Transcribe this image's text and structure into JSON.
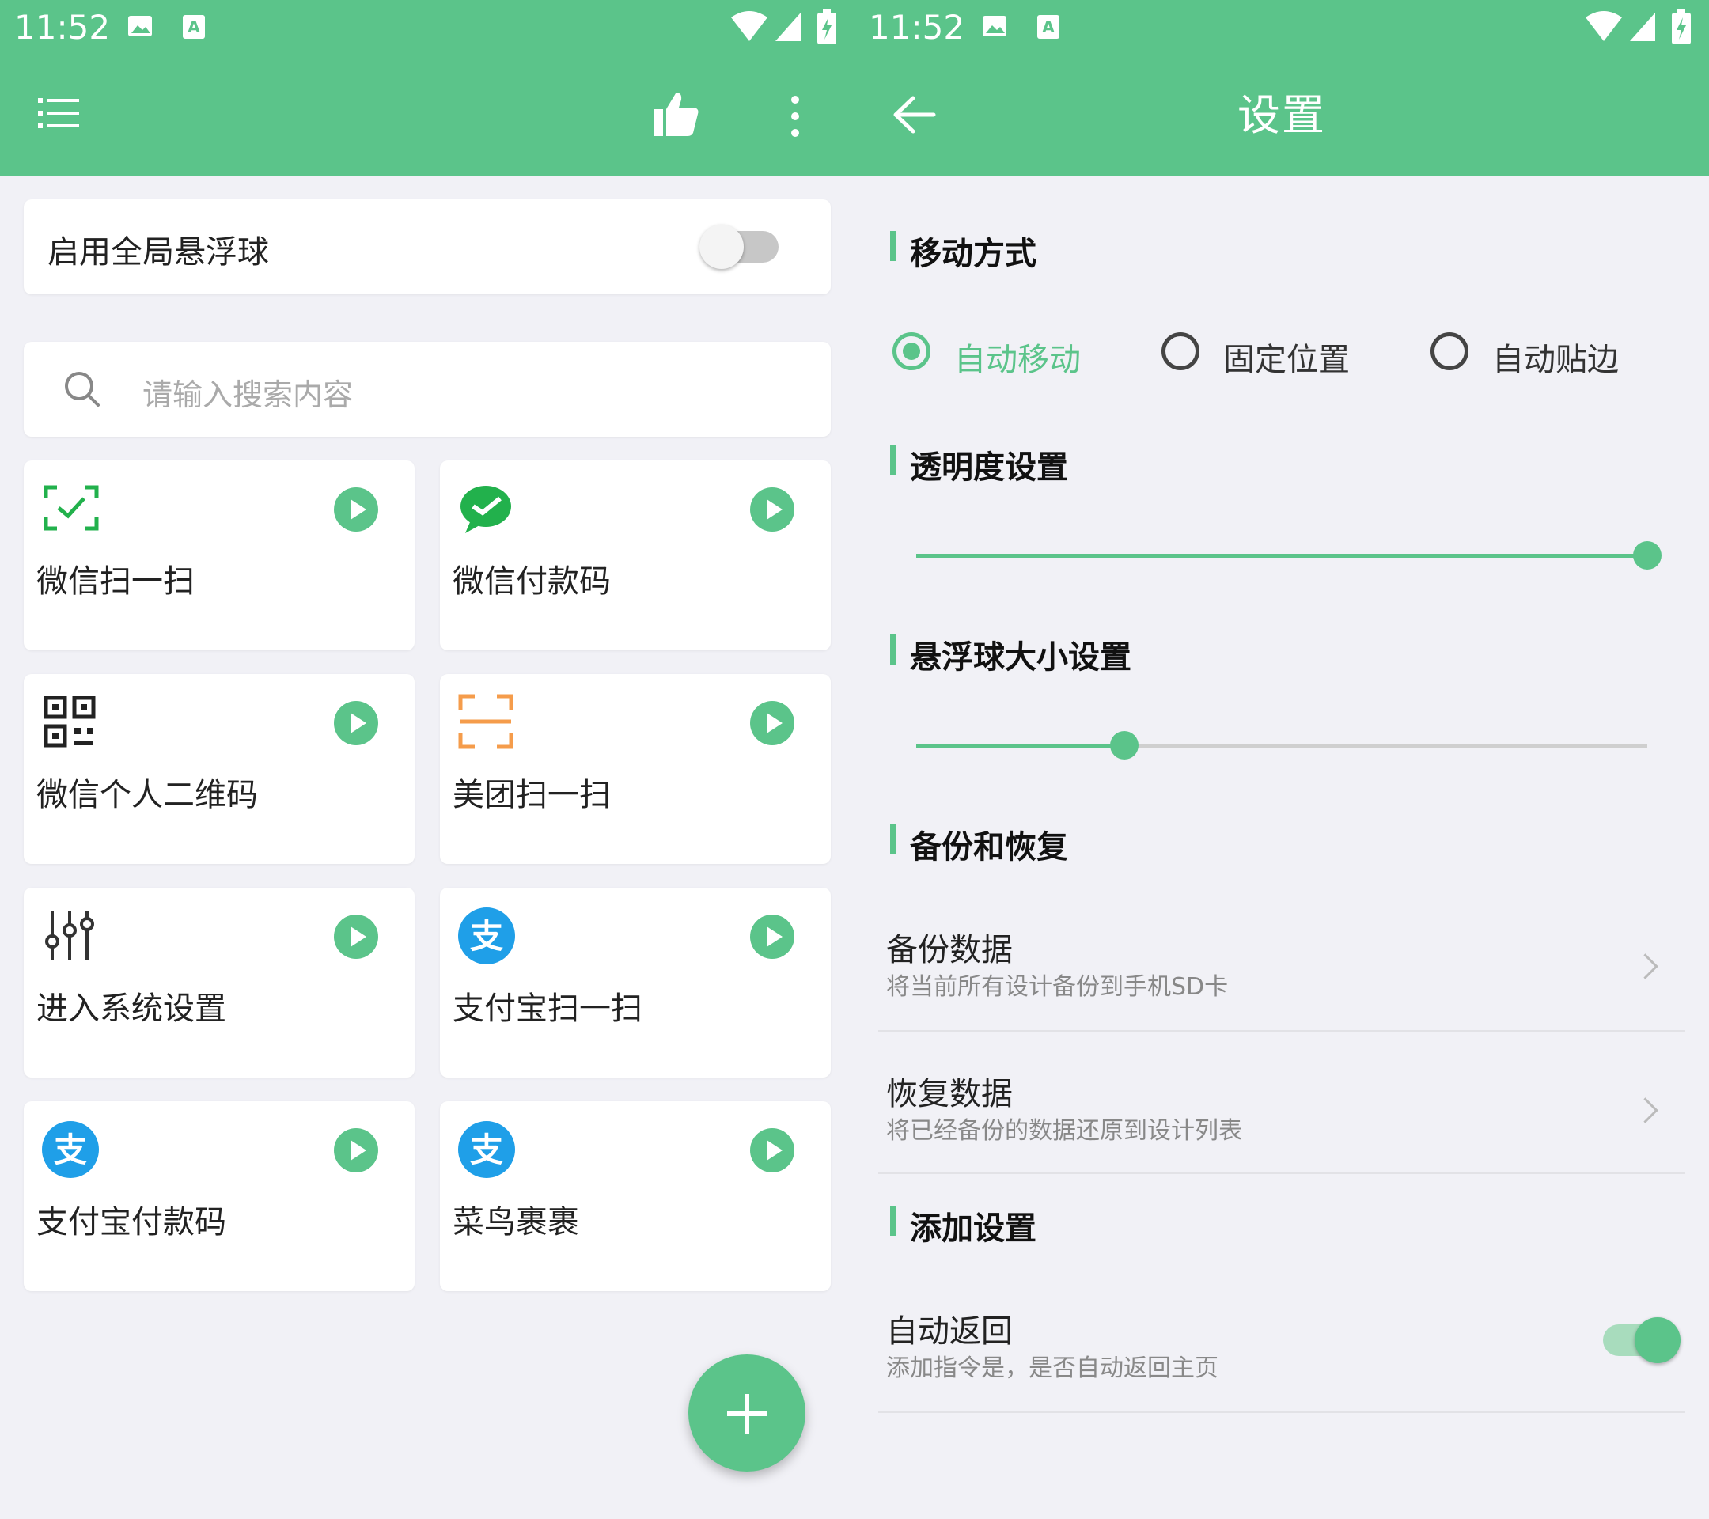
{
  "status": {
    "time_left": "11:52",
    "time_right": "11:52"
  },
  "main": {
    "global_ball_label": "启用全局悬浮球",
    "global_ball_enabled": false,
    "search_placeholder": "请输入搜索内容",
    "items": [
      {
        "label": "微信扫一扫",
        "icon": "wechat-scan-icon"
      },
      {
        "label": "微信付款码",
        "icon": "wechat-icon"
      },
      {
        "label": "微信个人二维码",
        "icon": "qr-code-icon"
      },
      {
        "label": "美团扫一扫",
        "icon": "scan-frame-icon"
      },
      {
        "label": "进入系统设置",
        "icon": "sliders-icon"
      },
      {
        "label": "支付宝扫一扫",
        "icon": "alipay-icon"
      },
      {
        "label": "支付宝付款码",
        "icon": "alipay-icon"
      },
      {
        "label": "菜鸟裹裹",
        "icon": "alipay-icon"
      }
    ]
  },
  "settings": {
    "title": "设置",
    "move_section": "移动方式",
    "move_options": [
      "自动移动",
      "固定位置",
      "自动贴边"
    ],
    "move_selected": 0,
    "opacity_section": "透明度设置",
    "opacity_value": 1.0,
    "size_section": "悬浮球大小设置",
    "size_value": 0.285,
    "backup_section": "备份和恢复",
    "backup_title": "备份数据",
    "backup_sub": "将当前所有设计备份到手机SD卡",
    "restore_title": "恢复数据",
    "restore_sub": "将已经备份的数据还原到设计列表",
    "add_section": "添加设置",
    "auto_return_title": "自动返回",
    "auto_return_sub": "添加指令是，是否自动返回主页",
    "auto_return_enabled": true
  },
  "colors": {
    "primary": "#5bc48a",
    "background": "#f1f1f6",
    "alipay": "#1f9fe8",
    "meituan": "#f59c4b",
    "wechat": "#22b14c"
  }
}
